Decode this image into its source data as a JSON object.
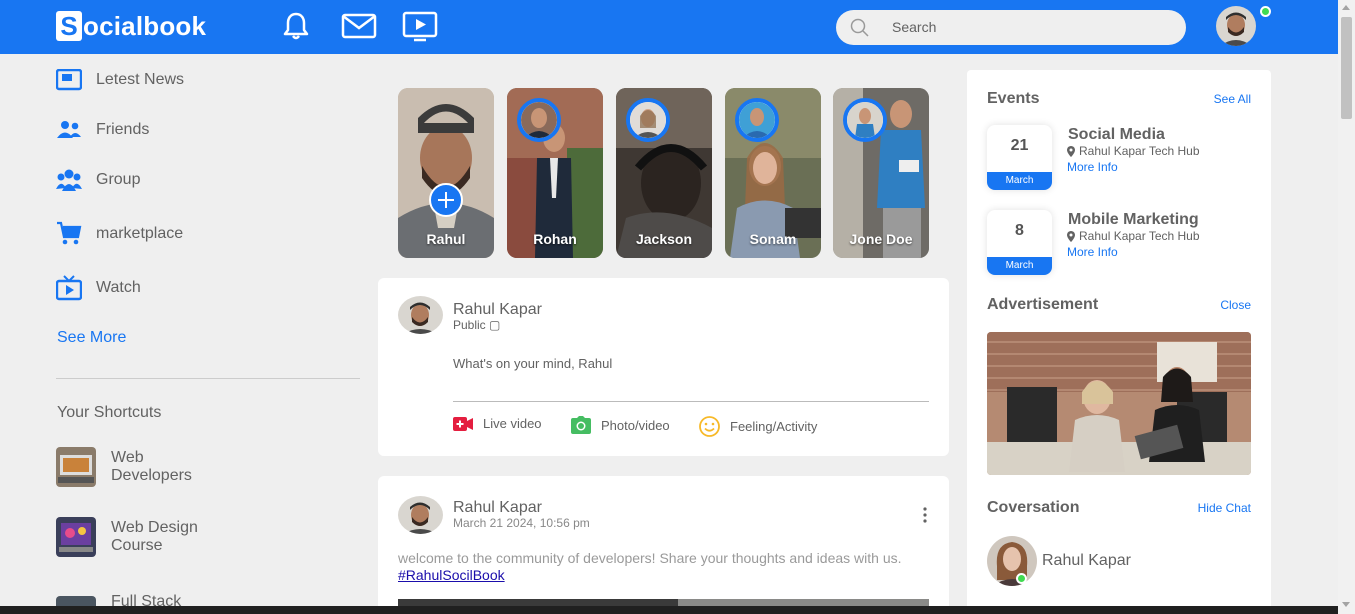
{
  "navbar": {
    "logo_letter": "S",
    "logo_rest": "ocialbook",
    "search_placeholder": "Search"
  },
  "sidebar": {
    "items": [
      {
        "label": "Letest News",
        "icon": "news-icon"
      },
      {
        "label": "Friends",
        "icon": "friends-icon"
      },
      {
        "label": "Group",
        "icon": "group-icon"
      },
      {
        "label": "marketplace",
        "icon": "cart-icon"
      },
      {
        "label": "Watch",
        "icon": "tv-icon"
      }
    ],
    "see_more": "See More",
    "shortcuts_title": "Your Shortcuts",
    "shortcuts": [
      {
        "label": "Web Developers"
      },
      {
        "label": "Web Design Course"
      },
      {
        "label": "Full Stack"
      }
    ]
  },
  "stories": [
    {
      "name": "Rahul"
    },
    {
      "name": "Rohan"
    },
    {
      "name": "Jackson"
    },
    {
      "name": "Sonam"
    },
    {
      "name": "Jone Doe"
    }
  ],
  "composer": {
    "user_name": "Rahul Kapar",
    "privacy": "Public ▢",
    "placeholder": "What's on your mind, Rahul",
    "actions": [
      {
        "label": "Live video",
        "icon": "live-video-icon"
      },
      {
        "label": "Photo/video",
        "icon": "camera-icon"
      },
      {
        "label": "Feeling/Activity",
        "icon": "smile-icon"
      }
    ]
  },
  "post": {
    "user_name": "Rahul Kapar",
    "timestamp": "March 21 2024, 10:56 pm",
    "text": "welcome to the community of developers! Share your thoughts and ideas with us. ",
    "hashtag": "#RahulSocilBook"
  },
  "events": {
    "title": "Events",
    "see_all": "See All",
    "items": [
      {
        "day": "21",
        "month": "March",
        "name": "Social Media",
        "location": "Rahul Kapar Tech Hub",
        "more": "More Info"
      },
      {
        "day": "8",
        "month": "March",
        "name": "Mobile Marketing",
        "location": "Rahul Kapar Tech Hub",
        "more": "More Info"
      }
    ]
  },
  "advertisement": {
    "title": "Advertisement",
    "close": "Close"
  },
  "conversation": {
    "title": "Coversation",
    "hide": "Hide Chat",
    "contact": "Rahul Kapar"
  },
  "colors": {
    "brand": "#1876f2",
    "online": "#41db51"
  }
}
